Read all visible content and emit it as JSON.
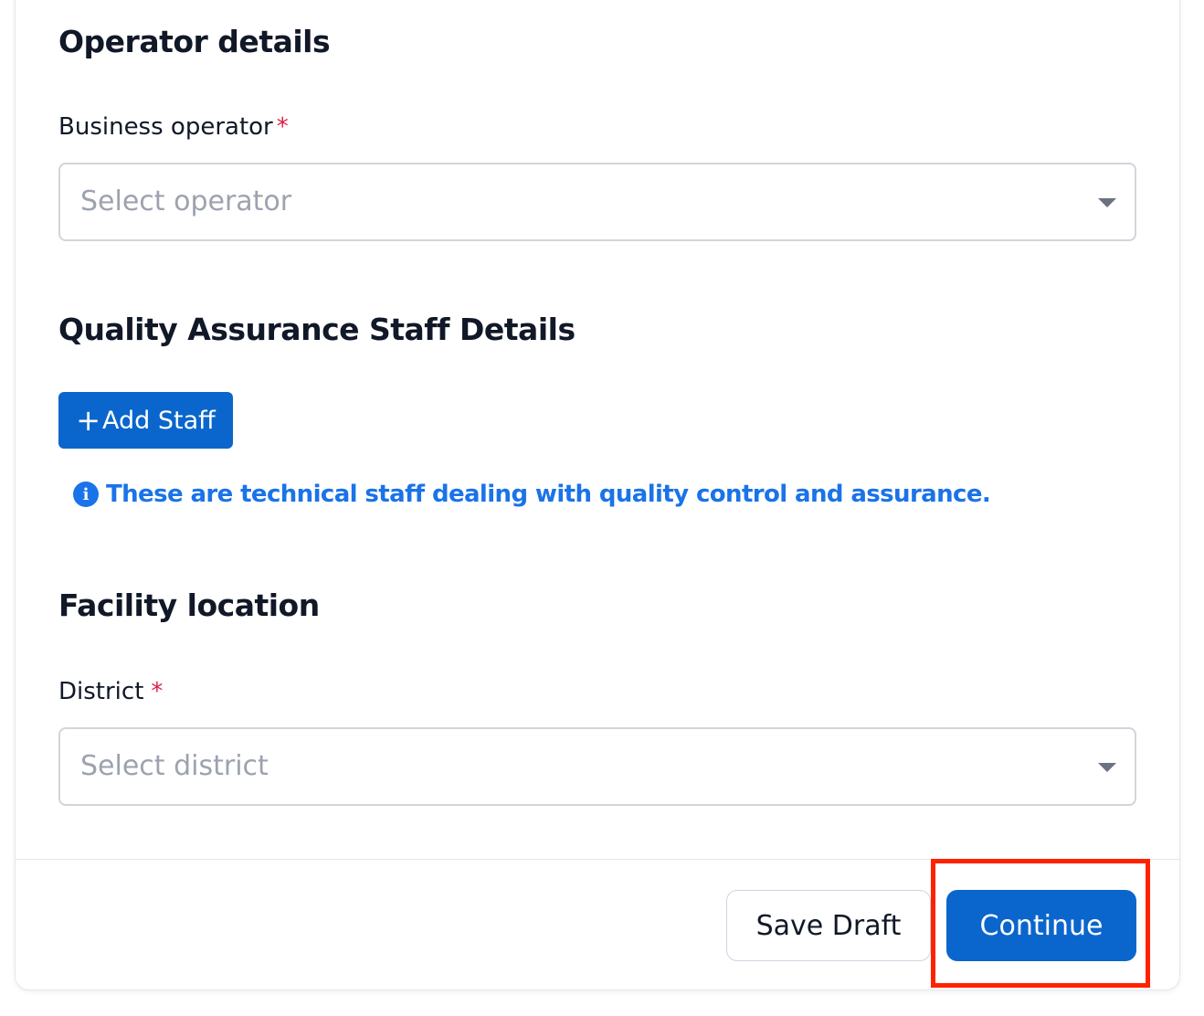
{
  "operator_section": {
    "title": "Operator details",
    "business_operator": {
      "label": "Business operator",
      "required_mark": "*",
      "placeholder": "Select operator"
    }
  },
  "qa_section": {
    "title": "Quality Assurance Staff Details",
    "add_staff_icon": "+",
    "add_staff_label": "Add Staff",
    "info_icon_glyph": "i",
    "info_text": "These are technical staff dealing with quality control and assurance."
  },
  "location_section": {
    "title": "Facility location",
    "district": {
      "label": "District",
      "required_mark": "*",
      "placeholder": "Select district"
    }
  },
  "footer": {
    "save_draft_label": "Save Draft",
    "continue_label": "Continue"
  },
  "colors": {
    "primary": "#0a66cc",
    "info": "#1a73e8",
    "required": "#e11d48",
    "highlight": "#ff2200"
  }
}
